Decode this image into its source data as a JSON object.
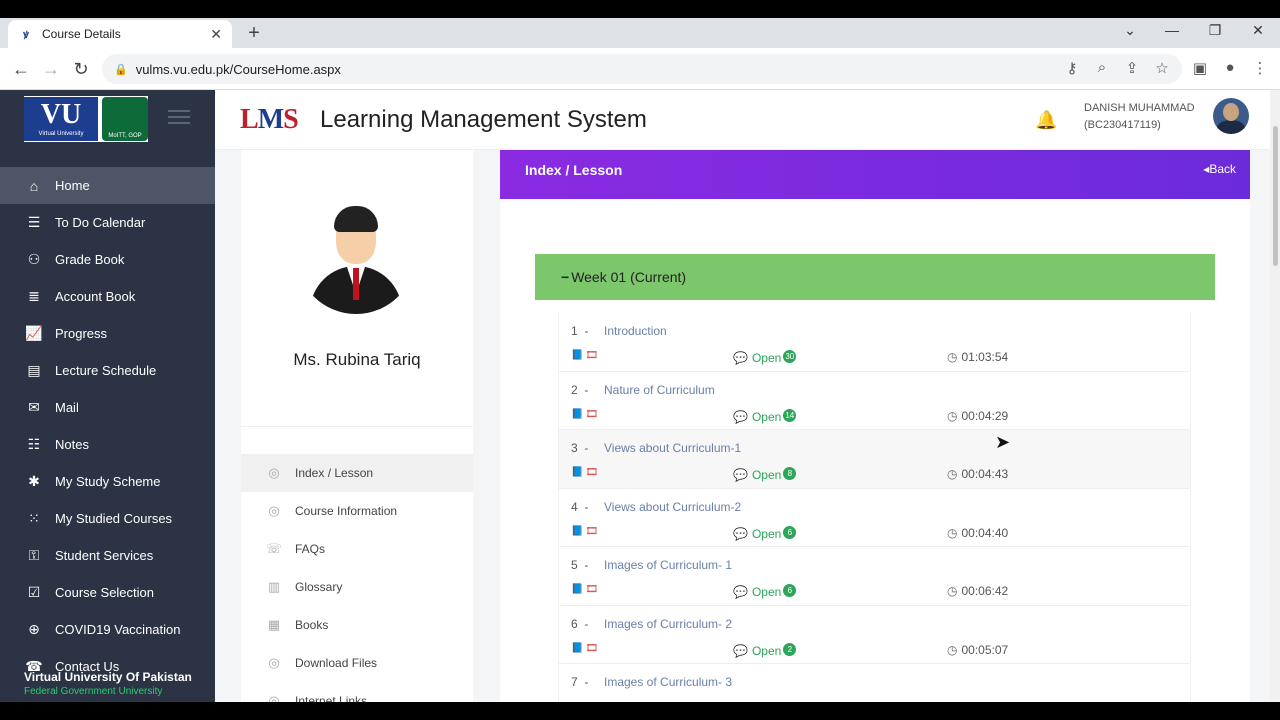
{
  "browser": {
    "tab_title": "Course Details",
    "tab_close": "✕",
    "new_tab": "+",
    "url": "vulms.vu.edu.pk/CourseHome.aspx"
  },
  "sidebar": {
    "logo_text": "VU",
    "logo_sub": "Virtual University",
    "seal_text": "MoITT, GOP",
    "items": [
      {
        "label": "Home",
        "icon": "home-icon",
        "glyph": "⌂"
      },
      {
        "label": "To Do Calendar",
        "icon": "list-icon",
        "glyph": "☰"
      },
      {
        "label": "Grade Book",
        "icon": "grade-icon",
        "glyph": "⚇"
      },
      {
        "label": "Account Book",
        "icon": "account-icon",
        "glyph": "≣"
      },
      {
        "label": "Progress",
        "icon": "chart-icon",
        "glyph": "📈"
      },
      {
        "label": "Lecture Schedule",
        "icon": "schedule-icon",
        "glyph": "▤"
      },
      {
        "label": "Mail",
        "icon": "mail-icon",
        "glyph": "✉"
      },
      {
        "label": "Notes",
        "icon": "notes-icon",
        "glyph": "☷"
      },
      {
        "label": "My Study Scheme",
        "icon": "scheme-icon",
        "glyph": "✱"
      },
      {
        "label": "My Studied Courses",
        "icon": "courses-icon",
        "glyph": "⁙"
      },
      {
        "label": "Student Services",
        "icon": "services-icon",
        "glyph": "⚿"
      },
      {
        "label": "Course Selection",
        "icon": "selection-icon",
        "glyph": "☑"
      },
      {
        "label": "COVID19 Vaccination",
        "icon": "vaccination-icon",
        "glyph": "⊕"
      },
      {
        "label": "Contact Us",
        "icon": "phone-icon",
        "glyph": "☎"
      }
    ],
    "footer_uni": "Virtual University Of Pakistan",
    "footer_fed": "Federal Government University"
  },
  "header": {
    "logo_l": "L",
    "logo_m": "M",
    "logo_s": "S",
    "title": "Learning Management System",
    "user_name": "DANISH MUHAMMAD",
    "user_id": "(BC230417119)"
  },
  "profile": {
    "instructor": "Ms. Rubina Tariq",
    "nav": [
      {
        "label": "Index / Lesson",
        "icon": "index-icon",
        "glyph": "◎"
      },
      {
        "label": "Course Information",
        "icon": "info-icon",
        "glyph": "◎"
      },
      {
        "label": "FAQs",
        "icon": "faq-icon",
        "glyph": "☏"
      },
      {
        "label": "Glossary",
        "icon": "glossary-icon",
        "glyph": "▥"
      },
      {
        "label": "Books",
        "icon": "books-icon",
        "glyph": "▦"
      },
      {
        "label": "Download Files",
        "icon": "download-icon",
        "glyph": "◎"
      },
      {
        "label": "Internet Links",
        "icon": "links-icon",
        "glyph": "◎"
      }
    ]
  },
  "lesson_panel": {
    "title": "Index / Lesson",
    "back": "◂Back",
    "week": "Week 01 (Current)",
    "week_toggle": "−",
    "open_label": "Open",
    "separator": "-",
    "lessons": [
      {
        "num": "1",
        "title": "Introduction",
        "badge": "30",
        "duration": "01:03:54"
      },
      {
        "num": "2",
        "title": "Nature of Curriculum",
        "badge": "14",
        "duration": "00:04:29"
      },
      {
        "num": "3",
        "title": "Views about Curriculum-1",
        "badge": "8",
        "duration": "00:04:43"
      },
      {
        "num": "4",
        "title": "Views about Curriculum-2",
        "badge": "6",
        "duration": "00:04:40"
      },
      {
        "num": "5",
        "title": "Images of Curriculum- 1",
        "badge": "6",
        "duration": "00:06:42"
      },
      {
        "num": "6",
        "title": "Images of Curriculum- 2",
        "badge": "2",
        "duration": "00:05:07"
      },
      {
        "num": "7",
        "title": "Images of Curriculum- 3",
        "badge": "",
        "duration": ""
      }
    ]
  }
}
